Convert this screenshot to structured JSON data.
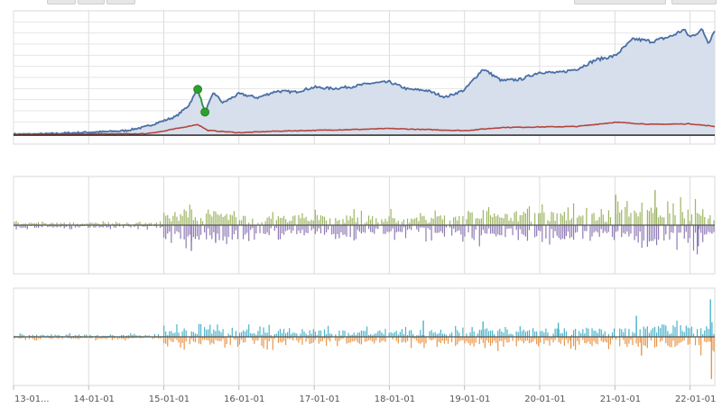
{
  "toolbar": {
    "left_buttons": [
      "",
      "",
      ""
    ],
    "right_buttons": [
      "",
      ""
    ]
  },
  "chart_data": [
    {
      "type": "area",
      "title": "",
      "xlabel": "",
      "ylabel": "",
      "x_range": [
        "2013-01-01",
        "2022-05-01"
      ],
      "ylim": [
        -0.1,
        5.0
      ],
      "grid": true,
      "colors": {
        "series_a": "#4a6fa5",
        "series_a_fill": "#d6dfeb",
        "series_b": "#b5443f",
        "baseline": "#333333",
        "highlight": "#2ca02c"
      },
      "series": [
        {
          "name": "",
          "points": [
            [
              "2013-01-01",
              0.0
            ],
            [
              "2013-04-01",
              0.0
            ],
            [
              "2013-07-01",
              0.02
            ],
            [
              "2013-10-01",
              0.05
            ],
            [
              "2014-01-01",
              0.08
            ],
            [
              "2014-04-01",
              0.1
            ],
            [
              "2014-07-01",
              0.14
            ],
            [
              "2014-10-01",
              0.28
            ],
            [
              "2015-01-01",
              0.52
            ],
            [
              "2015-03-01",
              0.68
            ],
            [
              "2015-05-01",
              1.1
            ],
            [
              "2015-06-15",
              1.72
            ],
            [
              "2015-07-20",
              0.85
            ],
            [
              "2015-09-01",
              1.6
            ],
            [
              "2015-10-15",
              1.2
            ],
            [
              "2016-01-01",
              1.55
            ],
            [
              "2016-04-01",
              1.4
            ],
            [
              "2016-07-01",
              1.65
            ],
            [
              "2016-10-01",
              1.62
            ],
            [
              "2017-01-01",
              1.8
            ],
            [
              "2017-04-01",
              1.75
            ],
            [
              "2017-07-01",
              1.82
            ],
            [
              "2017-10-01",
              1.95
            ],
            [
              "2018-01-01",
              2.0
            ],
            [
              "2018-04-01",
              1.72
            ],
            [
              "2018-07-01",
              1.68
            ],
            [
              "2018-10-01",
              1.42
            ],
            [
              "2019-01-01",
              1.7
            ],
            [
              "2019-04-01",
              2.5
            ],
            [
              "2019-07-01",
              2.05
            ],
            [
              "2019-10-01",
              2.1
            ],
            [
              "2020-01-01",
              2.38
            ],
            [
              "2020-04-01",
              2.35
            ],
            [
              "2020-07-01",
              2.5
            ],
            [
              "2020-10-01",
              2.85
            ],
            [
              "2021-01-01",
              3.0
            ],
            [
              "2021-04-01",
              3.65
            ],
            [
              "2021-07-01",
              3.55
            ],
            [
              "2021-10-01",
              3.75
            ],
            [
              "2021-12-01",
              4.0
            ],
            [
              "2022-01-01",
              3.72
            ],
            [
              "2022-03-01",
              4.0
            ],
            [
              "2022-04-01",
              3.5
            ],
            [
              "2022-05-01",
              4.0
            ]
          ]
        },
        {
          "name": "",
          "points": [
            [
              "2013-01-01",
              0.0
            ],
            [
              "2014-01-01",
              0.01
            ],
            [
              "2014-10-01",
              0.02
            ],
            [
              "2015-01-01",
              0.12
            ],
            [
              "2015-06-15",
              0.38
            ],
            [
              "2015-08-01",
              0.15
            ],
            [
              "2016-01-01",
              0.06
            ],
            [
              "2016-07-01",
              0.12
            ],
            [
              "2017-01-01",
              0.15
            ],
            [
              "2017-07-01",
              0.18
            ],
            [
              "2018-01-01",
              0.22
            ],
            [
              "2018-07-01",
              0.18
            ],
            [
              "2019-01-01",
              0.14
            ],
            [
              "2019-07-01",
              0.26
            ],
            [
              "2020-01-01",
              0.28
            ],
            [
              "2020-07-01",
              0.3
            ],
            [
              "2021-01-01",
              0.46
            ],
            [
              "2021-07-01",
              0.38
            ],
            [
              "2022-01-01",
              0.4
            ],
            [
              "2022-05-01",
              0.3
            ]
          ]
        }
      ],
      "highlight_points": [
        [
          "2015-06-15",
          1.72
        ],
        [
          "2015-07-20",
          0.85
        ]
      ]
    },
    {
      "type": "bar",
      "title": "",
      "ylim": [
        -1,
        1
      ],
      "colors": {
        "positive": "#9db562",
        "negative": "#8f7bb5"
      },
      "activity_profile": [
        {
          "from": "2013-01-01",
          "to": "2014-12-31",
          "amplitude": 0.06
        },
        {
          "from": "2015-01-01",
          "to": "2015-12-31",
          "amplitude": 0.35
        },
        {
          "from": "2016-01-01",
          "to": "2018-12-31",
          "amplitude": 0.22
        },
        {
          "from": "2019-01-01",
          "to": "2020-12-31",
          "amplitude": 0.3
        },
        {
          "from": "2021-01-01",
          "to": "2022-05-01",
          "amplitude": 0.4
        }
      ],
      "spikes": [
        [
          "2015-05-15",
          -0.55
        ],
        [
          "2015-09-10",
          -0.35
        ],
        [
          "2021-01-05",
          0.65
        ],
        [
          "2021-07-15",
          0.75
        ],
        [
          "2022-02-10",
          -0.45
        ],
        [
          "2019-01-20",
          0.3
        ],
        [
          "2020-05-01",
          -0.3
        ]
      ]
    },
    {
      "type": "bar",
      "title": "",
      "ylim": [
        -1,
        1
      ],
      "colors": {
        "positive": "#4ab3c9",
        "negative": "#e8954a"
      },
      "activity_profile": [
        {
          "from": "2013-01-01",
          "to": "2014-12-31",
          "amplitude": 0.05
        },
        {
          "from": "2015-01-01",
          "to": "2016-12-31",
          "amplitude": 0.18
        },
        {
          "from": "2017-01-01",
          "to": "2018-12-31",
          "amplitude": 0.15
        },
        {
          "from": "2019-01-01",
          "to": "2020-12-31",
          "amplitude": 0.2
        },
        {
          "from": "2021-01-01",
          "to": "2022-05-01",
          "amplitude": 0.25
        }
      ],
      "spikes": [
        [
          "2018-06-15",
          0.35
        ],
        [
          "2019-04-01",
          0.33
        ],
        [
          "2020-04-01",
          0.3
        ],
        [
          "2021-04-15",
          0.45
        ],
        [
          "2021-05-10",
          -0.4
        ],
        [
          "2022-04-10",
          0.8
        ],
        [
          "2022-04-15",
          -0.9
        ],
        [
          "2020-06-01",
          -0.25
        ]
      ]
    }
  ],
  "x_axis": {
    "ticks": [
      {
        "date": "2013-01-01",
        "label": "13-01..."
      },
      {
        "date": "2014-01-01",
        "label": "14-01-01"
      },
      {
        "date": "2015-01-01",
        "label": "15-01-01"
      },
      {
        "date": "2016-01-01",
        "label": "16-01-01"
      },
      {
        "date": "2017-01-01",
        "label": "17-01-01"
      },
      {
        "date": "2018-01-01",
        "label": "18-01-01"
      },
      {
        "date": "2019-01-01",
        "label": "19-01-01"
      },
      {
        "date": "2020-01-01",
        "label": "20-01-01"
      },
      {
        "date": "2021-01-01",
        "label": "21-01-01"
      },
      {
        "date": "2022-01-01",
        "label": "22-01-01"
      }
    ]
  }
}
